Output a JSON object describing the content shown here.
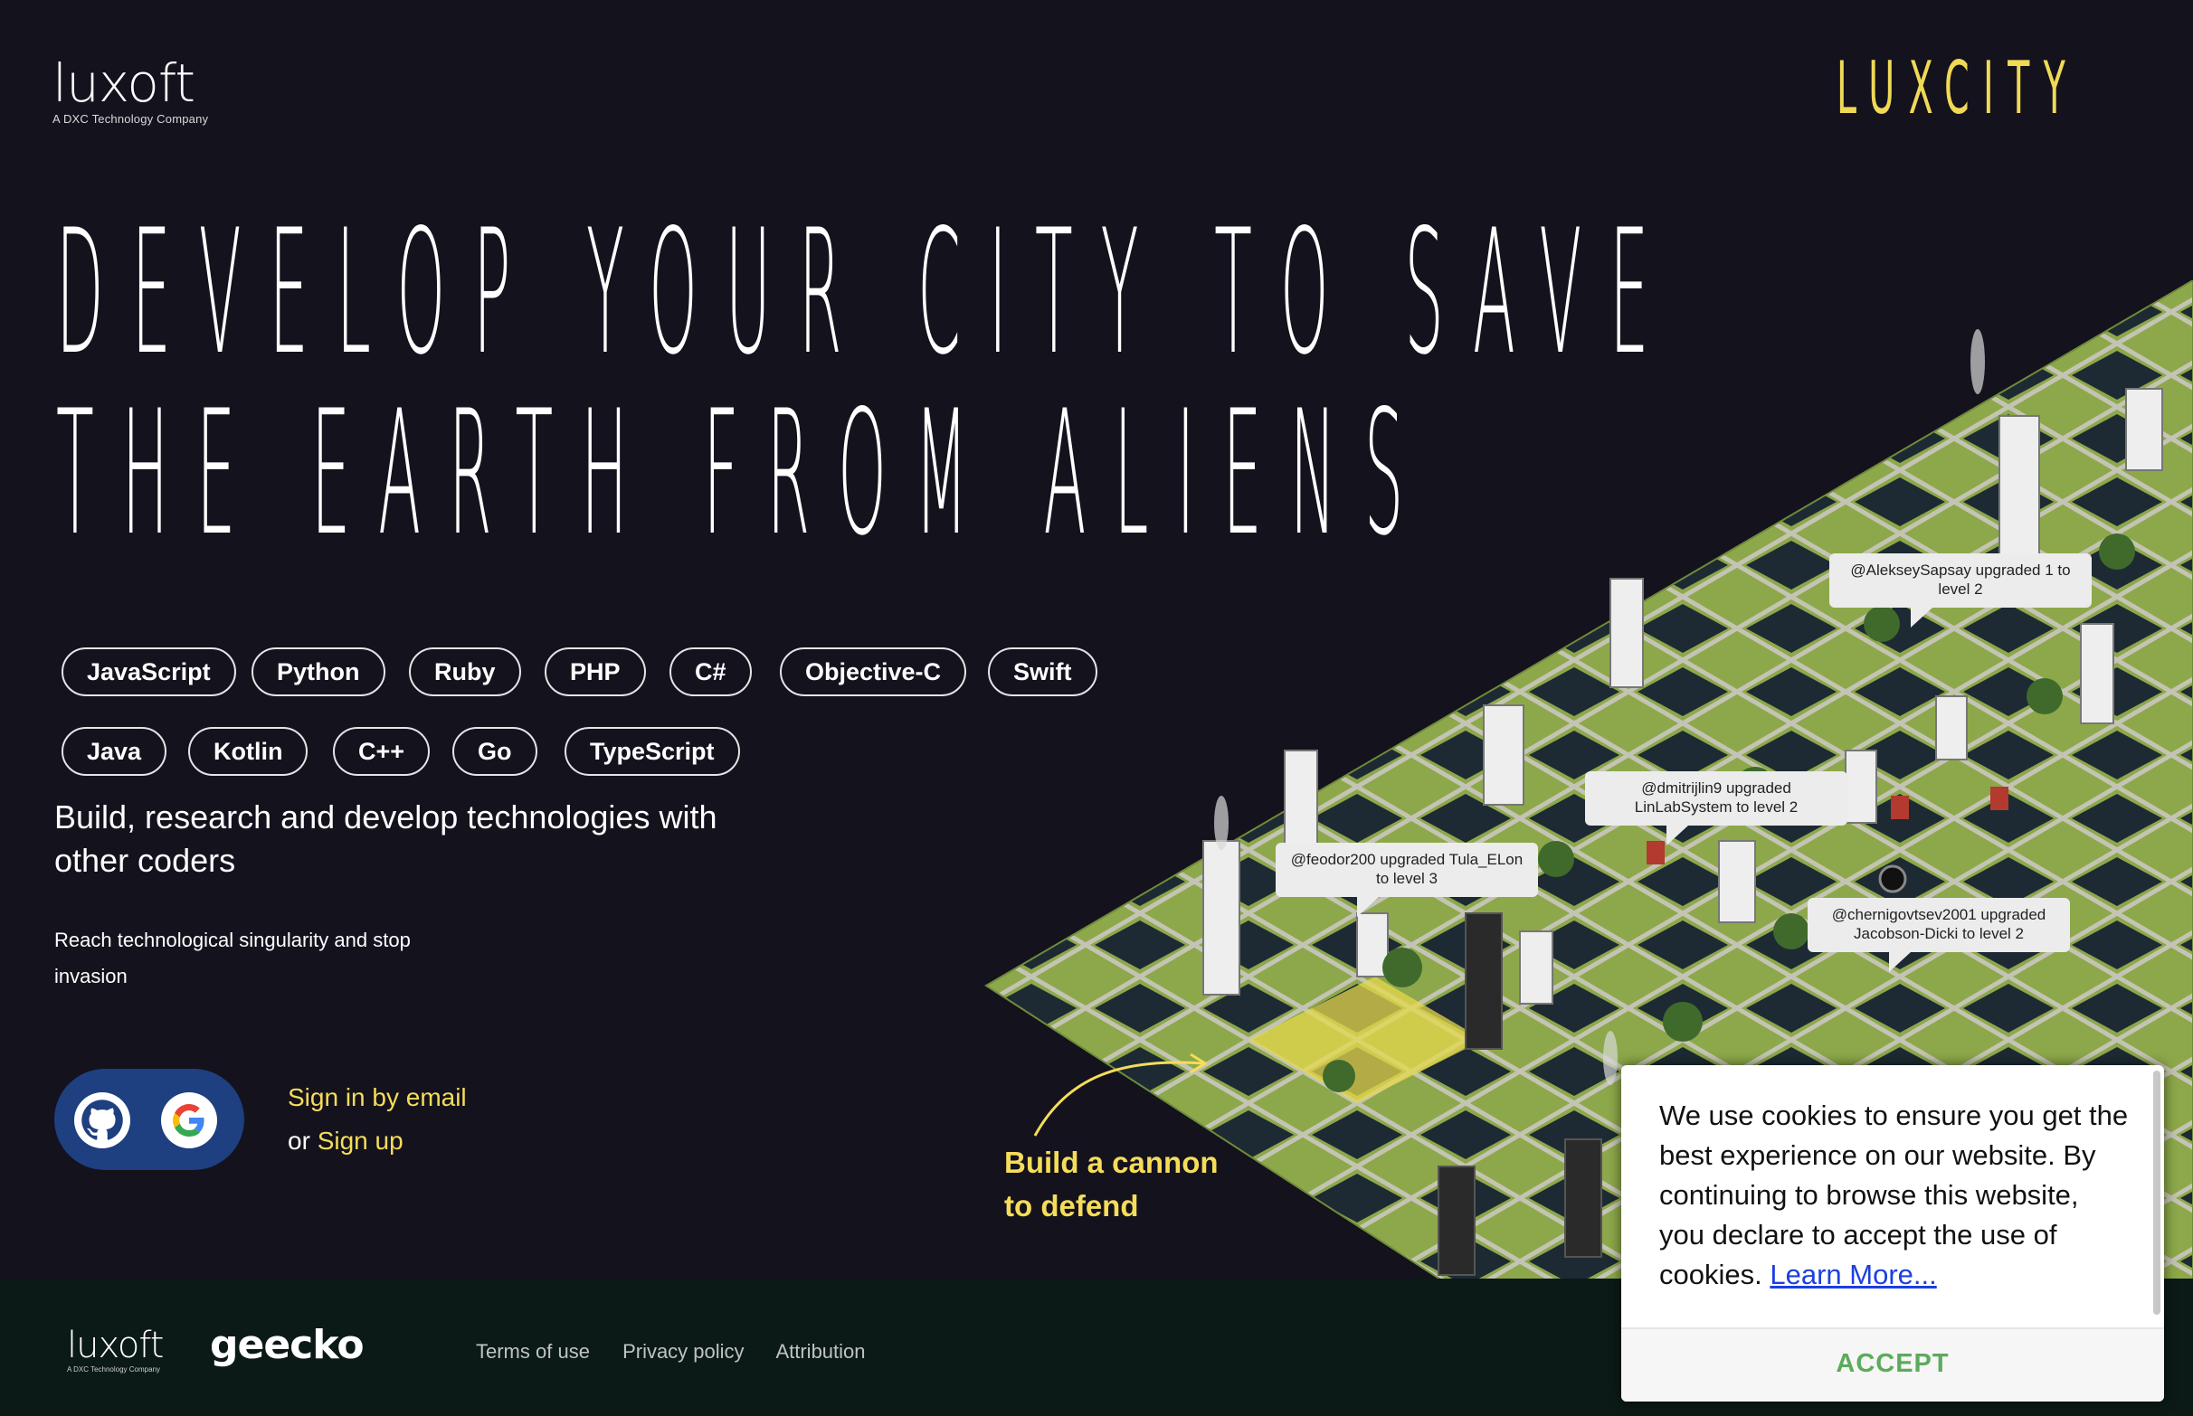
{
  "header": {
    "logo_word": "luxoft",
    "logo_sub": "A DXC Technology Company",
    "brand": "LUXCITY"
  },
  "hero": {
    "line1": "DEVELOP YOUR CITY TO SAVE",
    "line2": "THE EARTH FROM ALIENS"
  },
  "tags": [
    "JavaScript",
    "Python",
    "Ruby",
    "PHP",
    "C#",
    "Objective-C",
    "Swift",
    "Java",
    "Kotlin",
    "C++",
    "Go",
    "TypeScript"
  ],
  "description": {
    "main": "Build, research and develop technologies with other coders",
    "sub": "Reach technological singularity and stop invasion"
  },
  "auth": {
    "github_icon": "github-icon",
    "google_icon": "google-icon",
    "sign_in": "Sign in by email",
    "or": "or ",
    "sign_up": "Sign up"
  },
  "city": {
    "bubbles": [
      "@AlekseySapsay upgraded 1 to level 2",
      "@dmitrijlin9 upgraded LinLabSystem to level 2",
      "@feodor200 upgraded Tula_ELon to level 3",
      "@chernigovtsev2001 upgraded Jacobson-Dicki to level 2"
    ],
    "cannon_line1": "Build a cannon",
    "cannon_line2": "to defend"
  },
  "footer": {
    "luxoft": "luxoft",
    "luxoft_sub": "A DXC Technology Company",
    "geecko": "geecko",
    "links": [
      "Terms of use",
      "Privacy policy",
      "Attribution"
    ]
  },
  "cookie": {
    "text": "We use cookies to ensure you get the best experience on our website. By continuing to browse this website, you declare to accept the use of cookies.",
    "learn_more": "Learn More...",
    "accept": "ACCEPT"
  },
  "colors": {
    "background": "#14121d",
    "accent_yellow": "#f5dd5a",
    "auth_blue": "#1e3f80",
    "accept_green": "#5daa5d",
    "footer": "#0b1a17"
  }
}
